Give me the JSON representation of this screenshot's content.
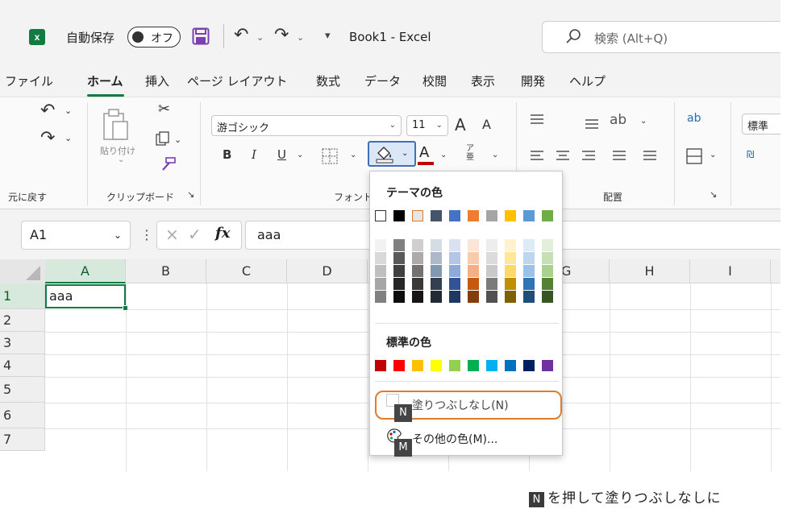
{
  "titlebar": {
    "app_icon": "excel-logo",
    "app_icon_letter": "x",
    "autosave_label": "自動保存",
    "autosave_state": "オフ",
    "undo_glyph": "↶",
    "redo_glyph": "↷",
    "dropdown_glyph": "⌄",
    "qat_more_glyph": "▾",
    "doc_title": "Book1 - Excel",
    "search_placeholder": "検索 (Alt+Q)"
  },
  "tabs": [
    {
      "label": "ファイル"
    },
    {
      "label": "ホーム",
      "active": true
    },
    {
      "label": "挿入"
    },
    {
      "label": "ページ レイアウト"
    },
    {
      "label": "数式"
    },
    {
      "label": "データ"
    },
    {
      "label": "校閲"
    },
    {
      "label": "表示"
    },
    {
      "label": "開発"
    },
    {
      "label": "ヘルプ"
    }
  ],
  "ribbon": {
    "undo_group_label": "元に戻す",
    "clipboard_group_label": "クリップボード",
    "paste_label": "貼り付け",
    "font_group_label": "フォント",
    "alignment_group_label": "配置",
    "font_name": "游ゴシック",
    "font_size": "11",
    "grow_font": "A",
    "shrink_font": "A",
    "bold": "B",
    "italic": "I",
    "underline": "U",
    "font_color_letter": "A",
    "number_format": "標準",
    "launcher_glyph": "↘",
    "small_dd": "⌄"
  },
  "formula_bar": {
    "name_box": "A1",
    "dropdown_glyph": "⌄",
    "dots": "⋮",
    "cancel_glyph": "×",
    "enter_glyph": "✓",
    "fx_label": "fx",
    "content": "aaa"
  },
  "sheet": {
    "columns": [
      "A",
      "B",
      "C",
      "D",
      "G",
      "H",
      "I"
    ],
    "rows": [
      "1",
      "2",
      "3",
      "4",
      "5",
      "6",
      "7"
    ],
    "cell_A1": "aaa"
  },
  "fill_dropdown": {
    "theme_heading": "テーマの色",
    "theme_top": [
      "#ffffff",
      "#000000",
      "#e7e6e6",
      "#44546a",
      "#4472c4",
      "#ed7d31",
      "#a5a5a5",
      "#ffc000",
      "#5b9bd5",
      "#70ad47"
    ],
    "theme_shades": [
      [
        "#f2f2f2",
        "#d9d9d9",
        "#bfbfbf",
        "#a6a6a6",
        "#808080"
      ],
      [
        "#808080",
        "#595959",
        "#404040",
        "#262626",
        "#0d0d0d"
      ],
      [
        "#d0cece",
        "#aeaaaa",
        "#757171",
        "#3a3838",
        "#171616"
      ],
      [
        "#d6dce4",
        "#adb9ca",
        "#8497b0",
        "#333f4f",
        "#222a35"
      ],
      [
        "#d9e1f2",
        "#b4c6e7",
        "#8ea9db",
        "#305496",
        "#203764"
      ],
      [
        "#fce4d6",
        "#f8cbad",
        "#f4b084",
        "#c65911",
        "#833c0b"
      ],
      [
        "#ededed",
        "#dbdbdb",
        "#c9c9c9",
        "#7b7b7b",
        "#525252"
      ],
      [
        "#fff2cc",
        "#ffe699",
        "#ffd966",
        "#bf8f00",
        "#7f6000"
      ],
      [
        "#ddebf7",
        "#bdd7ee",
        "#9bc2e6",
        "#2f75b5",
        "#1f4e78"
      ],
      [
        "#e2efda",
        "#c6e0b4",
        "#a9d08e",
        "#548235",
        "#375623"
      ]
    ],
    "standard_heading": "標準の色",
    "standard_colors": [
      "#c00000",
      "#ff0000",
      "#ffc000",
      "#ffff00",
      "#92d050",
      "#00b050",
      "#00b0f0",
      "#0070c0",
      "#002060",
      "#7030a0"
    ],
    "no_fill_label": "塗りつぶしなし(N)",
    "more_colors_label": "その他の色(M)...",
    "keytip_n": "N",
    "keytip_m": "M",
    "highlight_color": "#e07b2c"
  },
  "caption": {
    "key": "N",
    "text": "を押して塗りつぶしなしに"
  },
  "colors": {
    "excel_green": "#107c41",
    "font_color_bar": "#c00000",
    "save_icon": "#7a3fb0"
  }
}
